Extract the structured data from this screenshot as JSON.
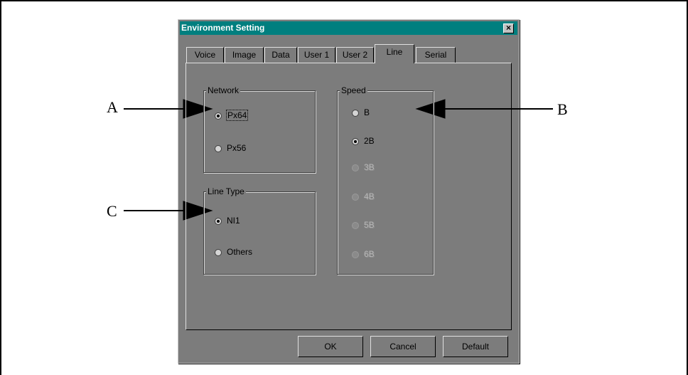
{
  "dialog": {
    "title": "Environment Setting",
    "close_label": "×"
  },
  "tabs": [
    {
      "label": "Voice"
    },
    {
      "label": "Image"
    },
    {
      "label": "Data"
    },
    {
      "label": "User 1"
    },
    {
      "label": "User 2"
    },
    {
      "label": "Line",
      "active": true
    },
    {
      "label": "Serial"
    }
  ],
  "network": {
    "legend": "Network",
    "options": [
      {
        "label": "Px64",
        "selected": true
      },
      {
        "label": "Px56",
        "selected": false
      }
    ]
  },
  "line_type": {
    "legend": "Line Type",
    "options": [
      {
        "label": "NI1",
        "selected": true
      },
      {
        "label": "Others",
        "selected": false
      }
    ]
  },
  "speed": {
    "legend": "Speed",
    "options": [
      {
        "label": "B",
        "selected": false,
        "enabled": true
      },
      {
        "label": "2B",
        "selected": true,
        "enabled": true
      },
      {
        "label": "3B",
        "selected": false,
        "enabled": false
      },
      {
        "label": "4B",
        "selected": false,
        "enabled": false
      },
      {
        "label": "5B",
        "selected": false,
        "enabled": false
      },
      {
        "label": "6B",
        "selected": false,
        "enabled": false
      }
    ]
  },
  "buttons": {
    "ok": "OK",
    "cancel": "Cancel",
    "default": "Default"
  },
  "callouts": {
    "a": "A",
    "b": "B",
    "c": "C"
  },
  "colors": {
    "title_bar": "#007f7f",
    "dialog_bg": "#7c7c7c"
  }
}
